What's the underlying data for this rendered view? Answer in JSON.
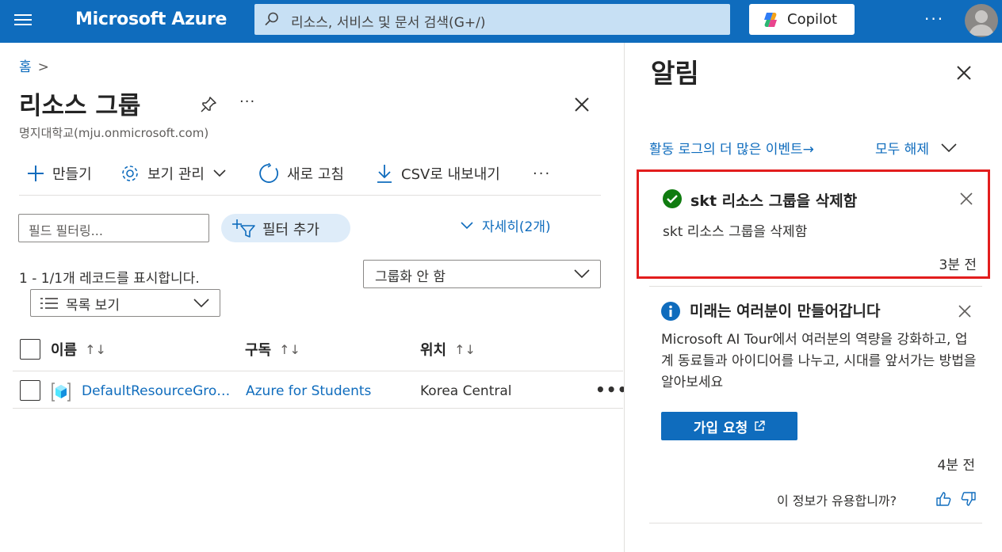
{
  "header": {
    "brand": "Microsoft Azure",
    "search_placeholder": "리소스, 서비스 및 문서 검색(G+/)",
    "copilot_label": "Copilot",
    "more_label": "···"
  },
  "blade": {
    "breadcrumb_home": "홈",
    "breadcrumb_sep": ">",
    "title": "리소스 그룹",
    "title_more": "···",
    "subtitle": "명지대학교(mju.onmicrosoft.com)",
    "toolbar": {
      "create": "만들기",
      "manage_view": "보기 관리",
      "refresh": "새로 고침",
      "export_csv": "CSV로 내보내기",
      "more": "···"
    },
    "filter_placeholder": "필드 필터링...",
    "add_filter": "필터 추가",
    "details_toggle": "자세히(2개)",
    "records_text": "1 - 1/1개 레코드를 표시합니다.",
    "grouping_value": "그룹화 안 함",
    "view_value": "목록 보기",
    "columns": {
      "name": "이름",
      "subscription": "구독",
      "location": "위치",
      "sort_glyph": "↑↓"
    },
    "rows": [
      {
        "name": "DefaultResourceGro…",
        "subscription": "Azure for Students",
        "location": "Korea Central",
        "more": "•••"
      }
    ]
  },
  "notifications": {
    "title": "알림",
    "activity_log_link": "활동 로그의 더 많은 이벤트→",
    "dismiss_all": "모두 해제",
    "items": [
      {
        "title": "skt 리소스 그룹을 삭제함",
        "body": "skt 리소스 그룹을 삭제함",
        "time": "3분 전",
        "status_color": "#107c10"
      },
      {
        "title": "미래는 여러분이 만들어갑니다",
        "body": "Microsoft AI Tour에서 여러분의 역량을 강화하고, 업계 동료들과 아이디어를 나누고, 시대를 앞서가는 방법을 알아보세요",
        "button": "가입 요청",
        "time": "4분 전",
        "feedback": "이 정보가 유용합니까?"
      }
    ]
  },
  "colors": {
    "accent": "#0f6cbd",
    "highlight_border": "#e21d1d"
  }
}
